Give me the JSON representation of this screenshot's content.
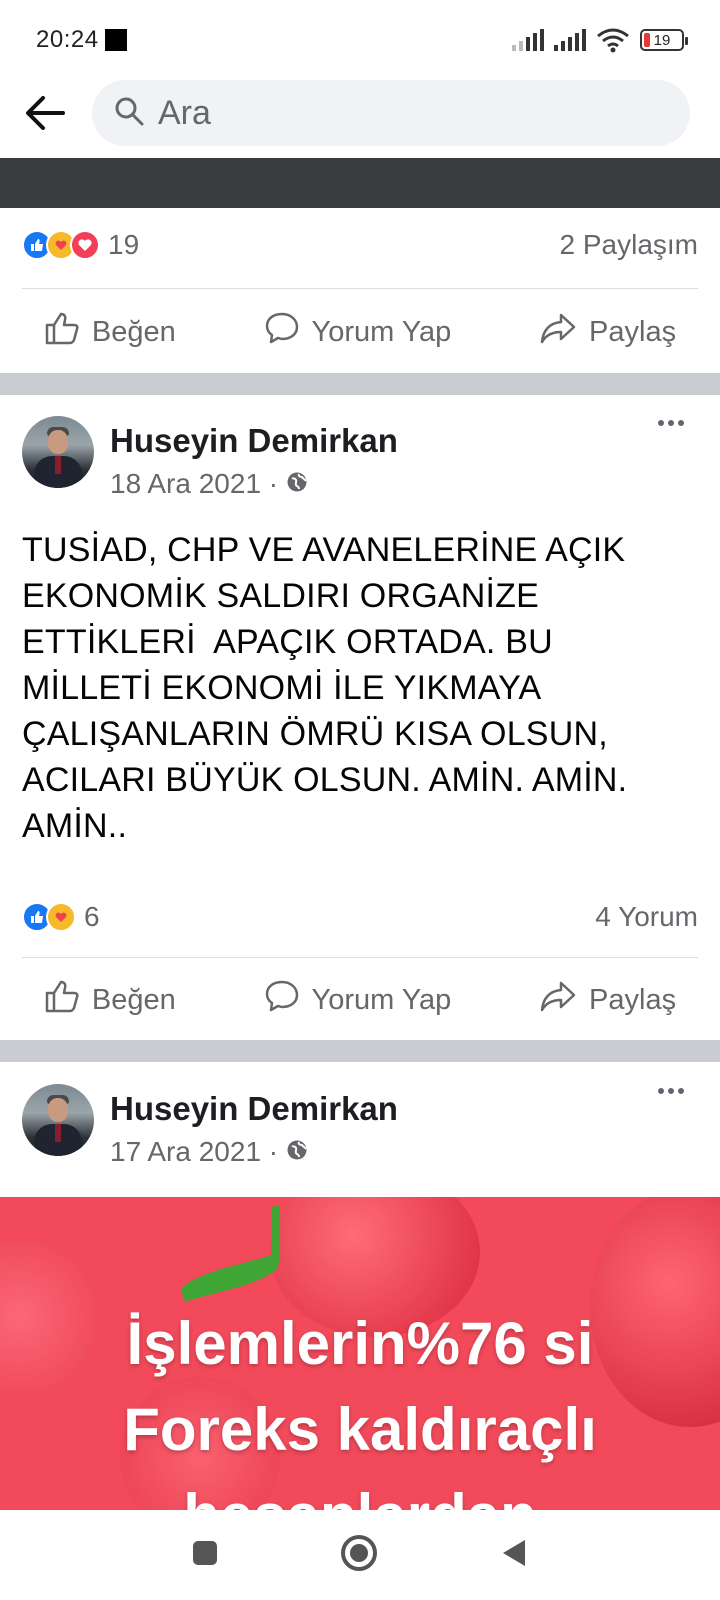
{
  "status": {
    "time": "20:24",
    "battery": "19"
  },
  "search": {
    "placeholder": "Ara"
  },
  "prev_post": {
    "reaction_count": "19",
    "share_count": "2 Paylaşım",
    "actions": {
      "like": "Beğen",
      "comment": "Yorum Yap",
      "share": "Paylaş"
    }
  },
  "post1": {
    "author": "Huseyin Demirkan",
    "date": "18 Ara 2021 ·",
    "lines": [
      "TUSİAD, CHP VE AVANELERİNE AÇIK",
      "EKONOMİK SALDIRI ORGANİZE",
      "ETTİKLERİ  APAÇIK ORTADA. BU",
      "MİLLETİ EKONOMİ İLE YIKMAYA",
      "ÇALIŞANLARIN ÖMRÜ KISA OLSUN,",
      "ACILARI BÜYÜK OLSUN. AMİN. AMİN.",
      "AMİN.."
    ],
    "reaction_count": "6",
    "comment_count": "4 Yorum",
    "actions": {
      "like": "Beğen",
      "comment": "Yorum Yap",
      "share": "Paylaş"
    }
  },
  "post2": {
    "author": "Huseyin Demirkan",
    "date": "17 Ara 2021 ·",
    "image_lines": [
      "İşlemlerin%76 si",
      "Foreks kaldıraçlı",
      "hesaplardan"
    ]
  },
  "icons": {
    "back": "back-arrow-icon",
    "search": "search-icon",
    "like": "thumbs-up-icon",
    "comment": "comment-bubble-icon",
    "share": "share-arrow-icon",
    "globe": "globe-icon",
    "more": "more-dots-icon",
    "nav_recent": "square-icon",
    "nav_home": "circle-icon",
    "nav_back": "triangle-icon"
  },
  "colors": {
    "like_blue": "#1877f2",
    "love_red": "#f33e58",
    "care_yellow": "#f7b928",
    "image_bg": "#f24a5a",
    "dark_band": "#3a3b3c"
  }
}
